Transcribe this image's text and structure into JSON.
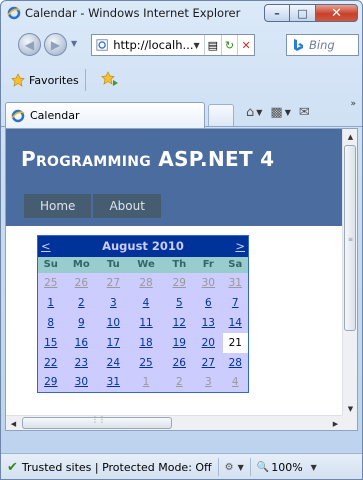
{
  "window": {
    "title": "Calendar - Windows Internet Explorer"
  },
  "nav": {
    "address": "http://localh...",
    "search_placeholder": "Bing"
  },
  "favorites": {
    "label": "Favorites"
  },
  "tab": {
    "label": "Calendar"
  },
  "site": {
    "title": "Programming ASP.NET 4",
    "menu": [
      "Home",
      "About"
    ]
  },
  "calendar": {
    "prev": "<",
    "next": ">",
    "month": "August 2010",
    "day_headers": [
      "Su",
      "Mo",
      "Tu",
      "We",
      "Th",
      "Fr",
      "Sa"
    ],
    "weeks": [
      [
        {
          "d": "25",
          "o": true
        },
        {
          "d": "26",
          "o": true
        },
        {
          "d": "27",
          "o": true
        },
        {
          "d": "28",
          "o": true
        },
        {
          "d": "29",
          "o": true
        },
        {
          "d": "30",
          "o": true
        },
        {
          "d": "31",
          "o": true
        }
      ],
      [
        {
          "d": "1"
        },
        {
          "d": "2"
        },
        {
          "d": "3"
        },
        {
          "d": "4"
        },
        {
          "d": "5"
        },
        {
          "d": "6"
        },
        {
          "d": "7"
        }
      ],
      [
        {
          "d": "8"
        },
        {
          "d": "9"
        },
        {
          "d": "10"
        },
        {
          "d": "11"
        },
        {
          "d": "12"
        },
        {
          "d": "13"
        },
        {
          "d": "14"
        }
      ],
      [
        {
          "d": "15"
        },
        {
          "d": "16"
        },
        {
          "d": "17"
        },
        {
          "d": "18"
        },
        {
          "d": "19"
        },
        {
          "d": "20"
        },
        {
          "d": "21",
          "t": true
        }
      ],
      [
        {
          "d": "22"
        },
        {
          "d": "23"
        },
        {
          "d": "24"
        },
        {
          "d": "25"
        },
        {
          "d": "26"
        },
        {
          "d": "27"
        },
        {
          "d": "28"
        }
      ],
      [
        {
          "d": "29"
        },
        {
          "d": "30"
        },
        {
          "d": "31"
        },
        {
          "d": "1",
          "o": true
        },
        {
          "d": "2",
          "o": true
        },
        {
          "d": "3",
          "o": true
        },
        {
          "d": "4",
          "o": true
        }
      ]
    ]
  },
  "status": {
    "text": "Trusted sites | Protected Mode: Off",
    "zoom": "100%"
  }
}
